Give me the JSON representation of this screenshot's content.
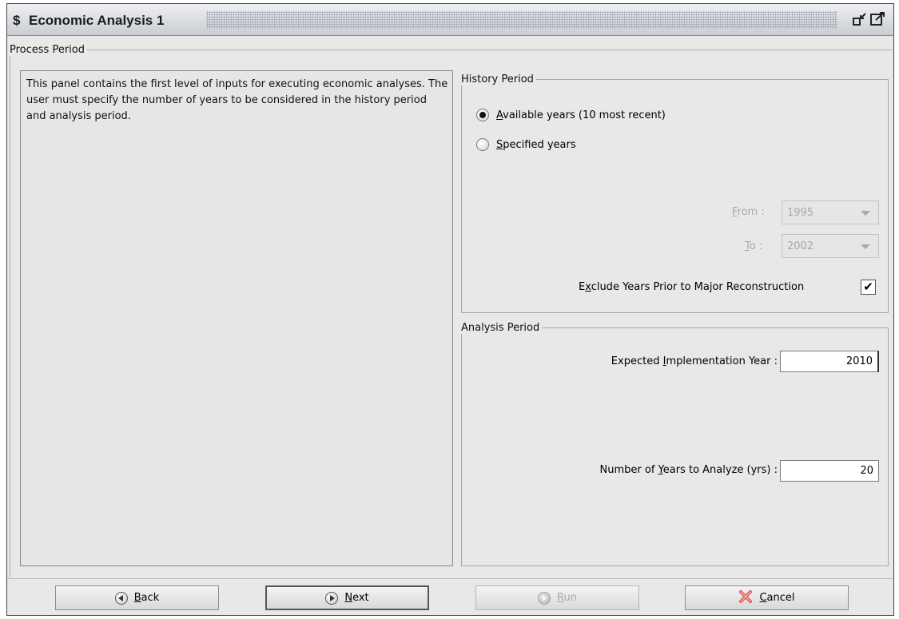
{
  "window": {
    "title_icon": "$",
    "title": "Economic Analysis 1",
    "restore_icon": "restore-icon",
    "maximize_icon": "maximize-icon"
  },
  "process_period": {
    "legend": "Process Period",
    "info_text": "This panel contains the first level of inputs for executing economic analyses. The user must specify the number of years to be considered in the history period and analysis period."
  },
  "history_period": {
    "legend": "History Period",
    "radio_available": {
      "label": "Available years (10 most recent)",
      "mnemonic": "A",
      "checked": true
    },
    "radio_specified": {
      "label": "Specified years",
      "mnemonic": "S",
      "checked": false
    },
    "from": {
      "label": "From :",
      "value": "1995",
      "enabled": false
    },
    "to": {
      "label": "To :",
      "value": "2002",
      "enabled": false
    },
    "exclude": {
      "label": "Exclude Years Prior to Major Reconstruction",
      "checked": true
    }
  },
  "analysis_period": {
    "legend": "Analysis Period",
    "implementation_year": {
      "label": "Expected Implementation Year :",
      "value": "2010"
    },
    "years_to_analyze": {
      "label": "Number of Years to Analyze (yrs) :",
      "value": "20"
    }
  },
  "buttons": {
    "back": "Back",
    "next": "Next",
    "run": "Run",
    "cancel": "Cancel"
  },
  "colors": {
    "panel_bg": "#e8e8e8",
    "disabled_text": "#a8a8a8",
    "cancel_icon": "#d9534f"
  }
}
